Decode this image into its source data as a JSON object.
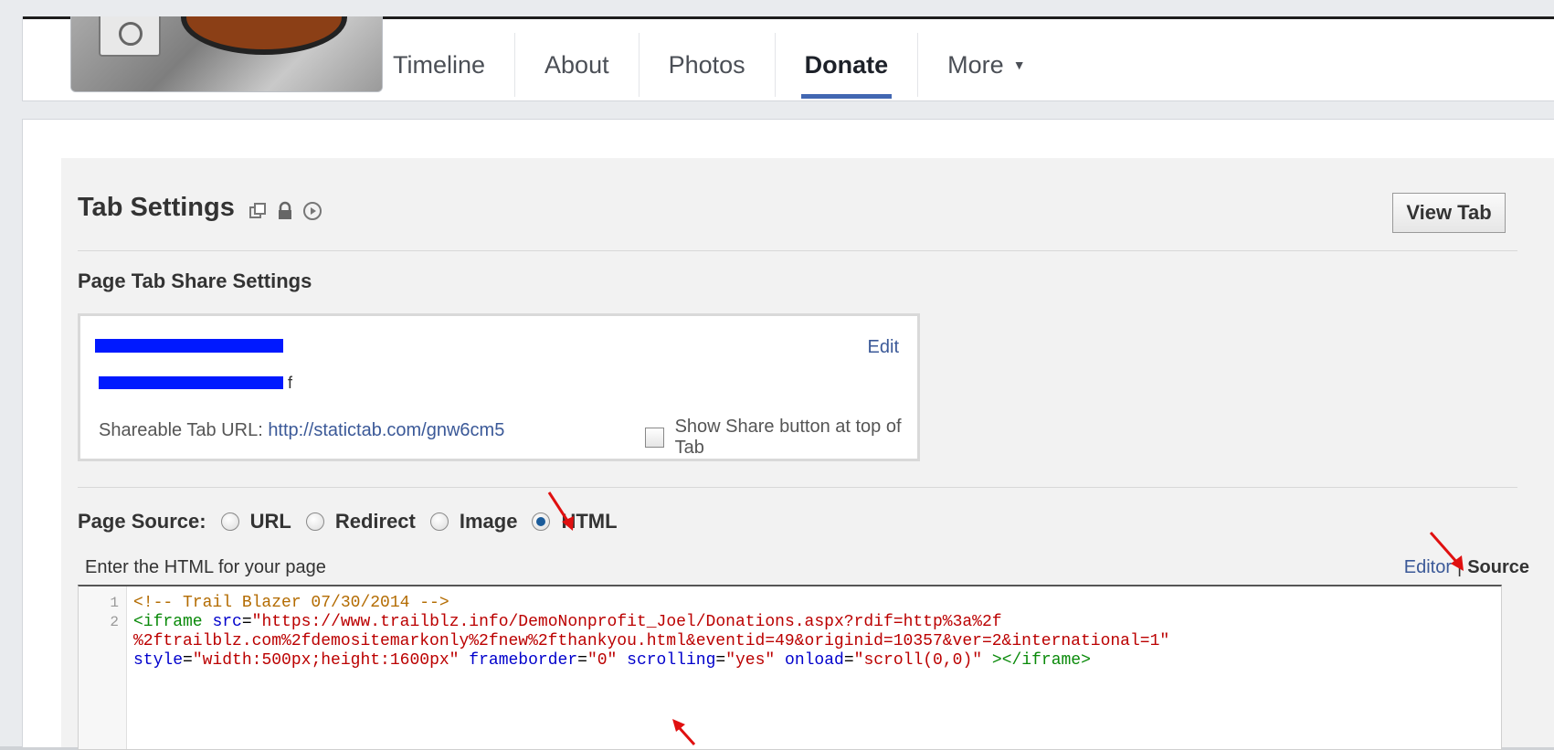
{
  "nav": {
    "tabs": [
      {
        "label": "Timeline"
      },
      {
        "label": "About"
      },
      {
        "label": "Photos"
      },
      {
        "label": "Donate"
      },
      {
        "label": "More"
      }
    ],
    "active_tab": "Donate",
    "accent_color": "#4267b2"
  },
  "settings": {
    "title": "Tab Settings",
    "view_tab_label": "View Tab",
    "share_section_title": "Page Tab Share Settings",
    "edit_label": "Edit",
    "shareable_url_label": "Shareable Tab URL:",
    "shareable_url": "http://statictab.com/gnw6cm5",
    "show_share_label": "Show Share button at top of Tab",
    "show_share_checked": false
  },
  "page_source": {
    "label": "Page Source:",
    "options": [
      {
        "label": "URL",
        "selected": false
      },
      {
        "label": "Redirect",
        "selected": false
      },
      {
        "label": "Image",
        "selected": false
      },
      {
        "label": "HTML",
        "selected": true
      }
    ],
    "enter_label": "Enter the HTML for your page",
    "editor_label": "Editor",
    "separator": "|",
    "source_label": "Source"
  },
  "code": {
    "line_numbers": [
      "1",
      "2"
    ],
    "line1": "<!-- Trail Blazer 07/30/2014 -->",
    "line2_tag_open": "<iframe",
    "line2_src_attr": "src",
    "line2_src_val_1": "\"https://www.trailblz.info/DemoNonprofit_Joel/Donations.aspx?rdif=http%3a%2f",
    "line2_src_val_2": "%2ftrailblz.com%2fdemositemarkonly%2fnew%2fthankyou.html&eventid=49&originid=10357&ver=2&international=1\"",
    "style_attr": "style",
    "style_val": "\"width:500px;height:1600px\"",
    "frameborder_attr": "frameborder",
    "frameborder_val": "\"0\"",
    "scrolling_attr": "scrolling",
    "scrolling_val": "\"yes\"",
    "onload_attr": "onload",
    "onload_val": "\"scroll(0,0)\"",
    "tag_close": "></iframe>"
  }
}
